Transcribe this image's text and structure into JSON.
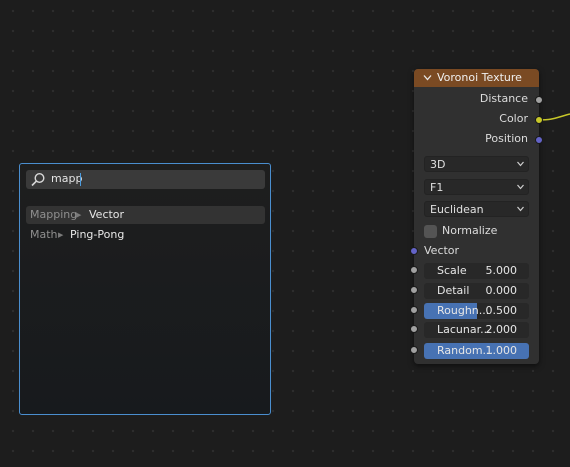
{
  "search": {
    "query": "mapp",
    "results": [
      {
        "category": "Mapping",
        "name": "Vector"
      },
      {
        "category": "Math",
        "name": "Ping-Pong"
      }
    ]
  },
  "node": {
    "title": "Voronoi Texture",
    "outputs": [
      "Distance",
      "Color",
      "Position"
    ],
    "dimensions": "3D",
    "feature": "F1",
    "metric": "Euclidean",
    "normalize_label": "Normalize",
    "normalize_checked": false,
    "vector_label": "Vector",
    "fields": [
      {
        "label": "Scale",
        "value": "5.000",
        "fill": 0
      },
      {
        "label": "Detail",
        "value": "0.000",
        "fill": 0
      },
      {
        "label": "Roughn...",
        "value": "0.500",
        "fill": 0.5
      },
      {
        "label": "Lacunar...",
        "value": "2.000",
        "fill": 0
      },
      {
        "label": "Random...",
        "value": "1.000",
        "fill": 1.0
      }
    ]
  },
  "colors": {
    "header": "#7a4a23",
    "accent": "#4772b3",
    "socket_gray": "#a1a1a1",
    "socket_yellow": "#c7c729",
    "socket_purple": "#6363c7",
    "popup_border": "#4a8ecf"
  }
}
